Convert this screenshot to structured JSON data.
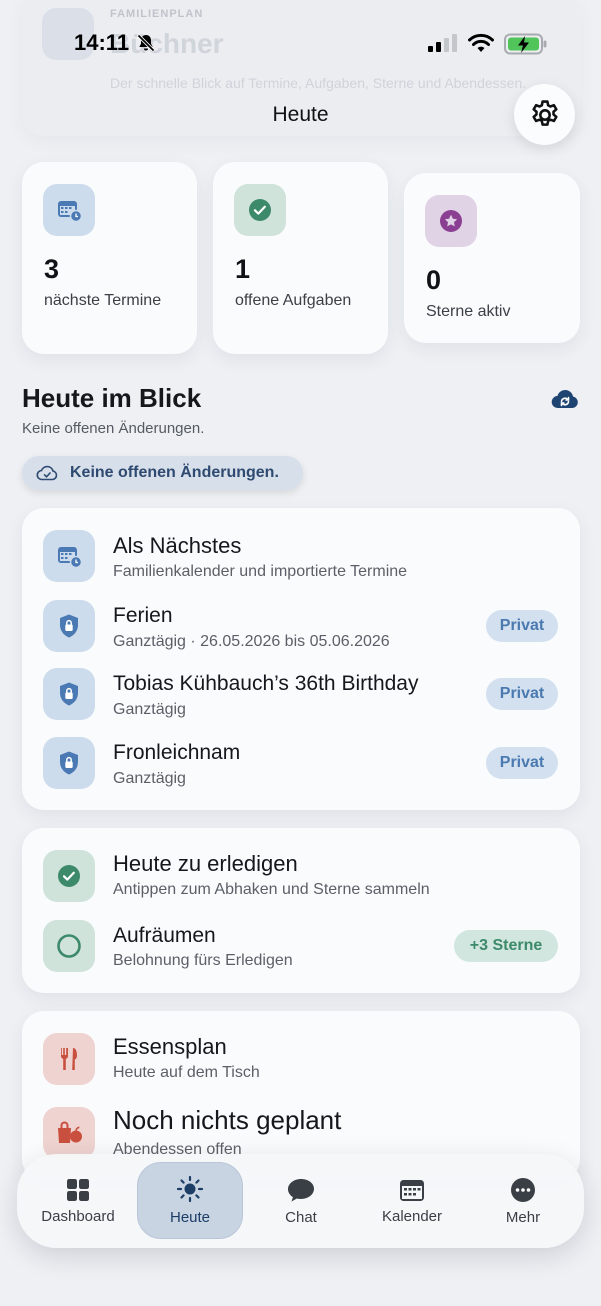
{
  "ghost_header": {
    "kicker": "FAMILIENPLAN",
    "title": "Büchner",
    "subtitle": "Der schnelle Blick auf Termine, Aufgaben, Sterne und Abendessen."
  },
  "status_bar": {
    "time": "14:11"
  },
  "nav": {
    "title": "Heute",
    "settings_icon": "gear-icon"
  },
  "stats": [
    {
      "value": "3",
      "label": "nächste Termine",
      "icon": "calendar-icon",
      "color": "#4a79b4"
    },
    {
      "value": "1",
      "label": "offene Aufgaben",
      "icon": "check-circle-icon",
      "color": "#3d8a6b"
    },
    {
      "value": "0",
      "label": "Sterne aktiv",
      "icon": "star-icon",
      "color": "#8a3f93"
    }
  ],
  "overview": {
    "title": "Heute im Blick",
    "subtitle": "Keine offenen Änderungen.",
    "chip_label": "Keine offenen Änderungen."
  },
  "next_section": {
    "title": "Als Nächstes",
    "subtitle": "Familienkalender und importierte Termine",
    "events": [
      {
        "title": "Ferien",
        "subtitle": "Ganztägig · 26.05.2026 bis 05.06.2026",
        "badge": "Privat"
      },
      {
        "title": "Tobias Kühbauch’s 36th Birthday",
        "subtitle": "Ganztägig",
        "badge": "Privat"
      },
      {
        "title": "Fronleichnam",
        "subtitle": "Ganztägig",
        "badge": "Privat"
      }
    ]
  },
  "todo_section": {
    "title": "Heute zu erledigen",
    "subtitle": "Antippen zum Abhaken und Sterne sammeln",
    "tasks": [
      {
        "title": "Aufräumen",
        "subtitle": "Belohnung fürs Erledigen",
        "badge": "+3 Sterne"
      }
    ]
  },
  "meal_section": {
    "title": "Essensplan",
    "subtitle": "Heute auf dem Tisch",
    "meal_title": "Noch nichts geplant",
    "meal_subtitle": "Abendessen offen"
  },
  "tabbar": {
    "tabs": [
      {
        "label": "Dashboard",
        "icon": "grid-icon"
      },
      {
        "label": "Heute",
        "icon": "sun-icon",
        "active": true
      },
      {
        "label": "Chat",
        "icon": "chat-bubble-icon"
      },
      {
        "label": "Kalender",
        "icon": "calendar-icon"
      },
      {
        "label": "Mehr",
        "icon": "more-dots-icon"
      }
    ]
  }
}
